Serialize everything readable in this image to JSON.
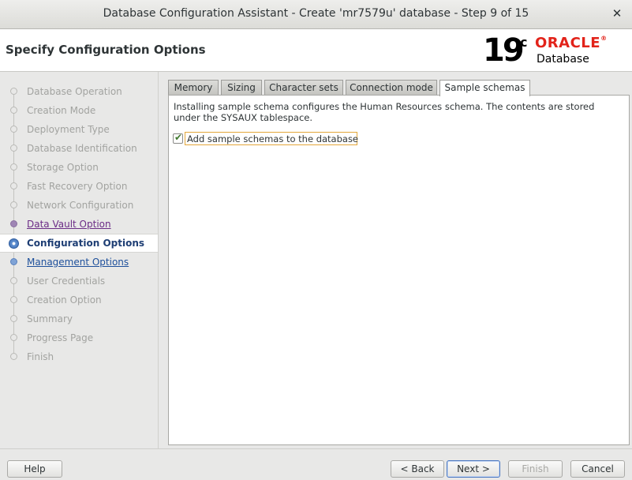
{
  "window": {
    "title": "Database Configuration Assistant - Create 'mr7579u' database - Step 9 of 15",
    "close_glyph": "✕"
  },
  "header": {
    "page_title": "Specify Configuration Options",
    "logo": {
      "version": "19",
      "version_sup": "c",
      "brand": "ORACLE",
      "registered": "®",
      "product": "Database"
    }
  },
  "steps": [
    {
      "label": "Database Operation",
      "state": "disabled"
    },
    {
      "label": "Creation Mode",
      "state": "disabled"
    },
    {
      "label": "Deployment Type",
      "state": "disabled"
    },
    {
      "label": "Database Identification",
      "state": "disabled"
    },
    {
      "label": "Storage Option",
      "state": "disabled"
    },
    {
      "label": "Fast Recovery Option",
      "state": "disabled"
    },
    {
      "label": "Network Configuration",
      "state": "disabled"
    },
    {
      "label": "Data Vault Option",
      "state": "visited"
    },
    {
      "label": "Configuration Options",
      "state": "current"
    },
    {
      "label": "Management Options",
      "state": "link"
    },
    {
      "label": "User Credentials",
      "state": "disabled"
    },
    {
      "label": "Creation Option",
      "state": "disabled"
    },
    {
      "label": "Summary",
      "state": "disabled"
    },
    {
      "label": "Progress Page",
      "state": "disabled"
    },
    {
      "label": "Finish",
      "state": "disabled"
    }
  ],
  "tabs": [
    {
      "label": "Memory"
    },
    {
      "label": "Sizing"
    },
    {
      "label": "Character sets"
    },
    {
      "label": "Connection mode"
    },
    {
      "label": "Sample schemas",
      "active": true
    }
  ],
  "panel": {
    "description": "Installing sample schema configures the Human Resources schema. The contents are stored under the SYSAUX tablespace.",
    "checkbox_label": "Add sample schemas to the database",
    "checkbox_checked": true,
    "check_glyph": "✔"
  },
  "buttons": {
    "help": "Help",
    "back": "< Back",
    "next": "Next >",
    "finish": "Finish",
    "cancel": "Cancel"
  }
}
